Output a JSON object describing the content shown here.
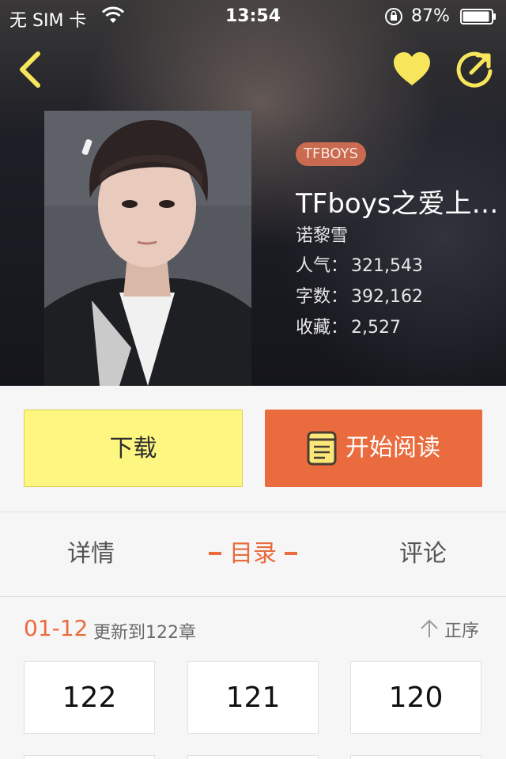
{
  "status_bar": {
    "carrier": "无 SIM 卡",
    "time": "13:54",
    "battery": "87%"
  },
  "header": {
    "back_icon": "chevron-left-icon",
    "favorite_icon": "heart-icon",
    "share_icon": "share-icon",
    "accent_color": "#f7e65c"
  },
  "book": {
    "tag": "TFBOYS",
    "title": "TFboys之爱上…",
    "author": "诺黎雪",
    "popularity_label": "人气：",
    "popularity": "321,543",
    "words_label": "字数：",
    "words": "392,162",
    "favorites_label": "收藏：",
    "favorites": "2,527"
  },
  "actions": {
    "download": "下载",
    "read": "开始阅读",
    "read_icon": "book-icon",
    "download_color": "#fdf782",
    "read_color": "#ea6b3d"
  },
  "tabs": {
    "details": "详情",
    "toc": "目录",
    "comments": "评论",
    "active": "toc"
  },
  "toc": {
    "range": "01-12",
    "update": "更新到122章",
    "sort": "正序",
    "chapters": [
      "122",
      "121",
      "120"
    ]
  }
}
